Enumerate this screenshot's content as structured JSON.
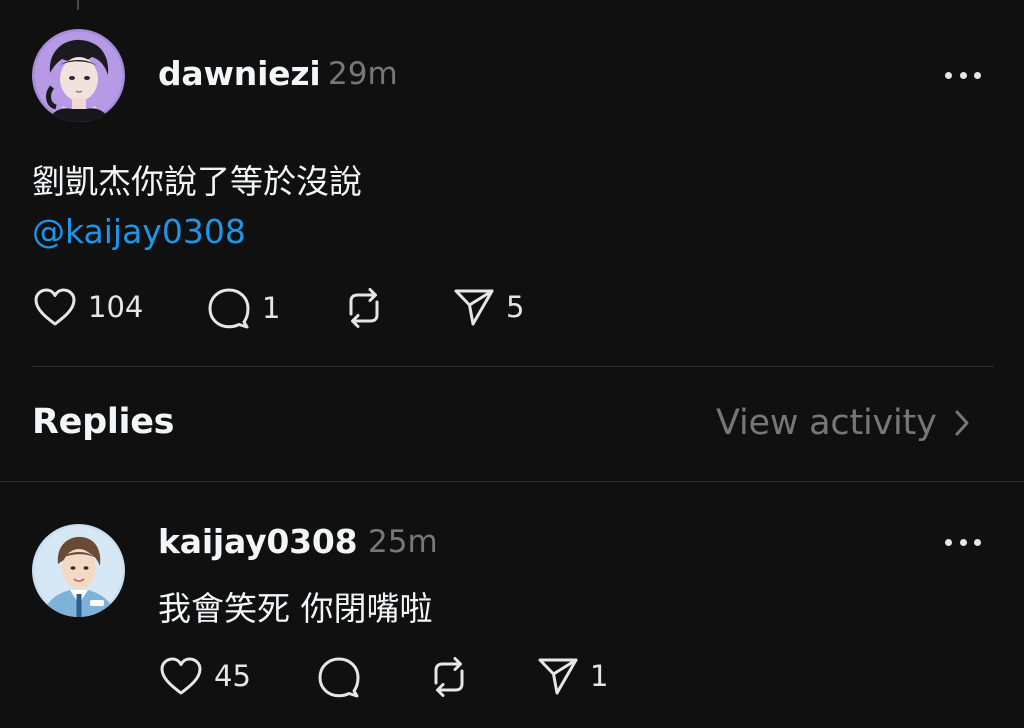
{
  "post": {
    "author": "dawniezi",
    "time": "29m",
    "text": "劉凱杰你說了等於沒說",
    "mention": "@kaijay0308",
    "likes": "104",
    "comments": "1",
    "shares": "5"
  },
  "replies_section": {
    "heading": "Replies",
    "view_activity_label": "View activity"
  },
  "reply": {
    "author": "kaijay0308",
    "time": "25m",
    "text": "我會笑死 你閉嘴啦",
    "likes": "45",
    "shares": "1"
  },
  "colors": {
    "background": "#101010",
    "text_primary": "#f3f5f7",
    "text_secondary": "#777777",
    "mention": "#1e95e9",
    "divider": "#2e2e2e"
  },
  "icons": [
    "heart-icon",
    "comment-icon",
    "repost-icon",
    "send-icon",
    "more-icon",
    "chevron-right-icon"
  ]
}
